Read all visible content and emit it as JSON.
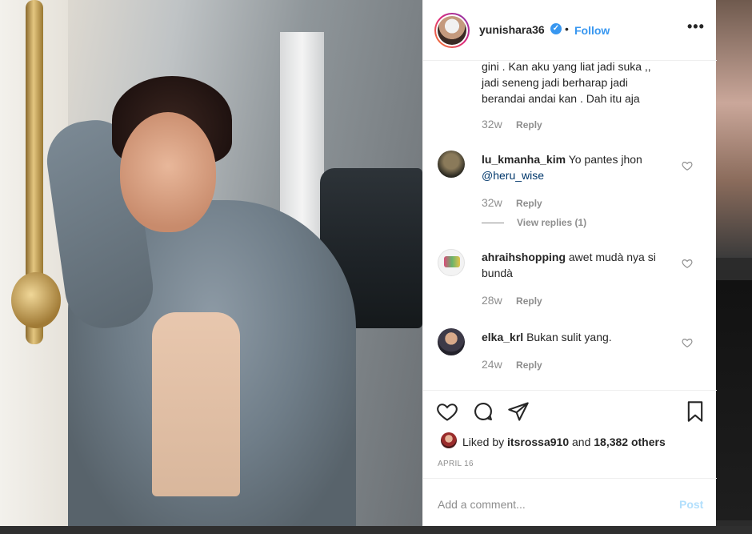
{
  "post": {
    "username": "yunishara36",
    "follow_label": "Follow",
    "separator": "•",
    "more_label": "•••"
  },
  "comments": [
    {
      "id": "c0",
      "text_lines": [
        "gini . Kan aku yang liat jadi suka ,,",
        "jadi seneng jadi berharap jadi",
        "berandai andai kan . Dah itu aja"
      ],
      "age": "32w",
      "reply_label": "Reply"
    },
    {
      "id": "c1",
      "username": "lu_kmanha_kim",
      "text": "Yo pantes jhon",
      "mention": "@heru_wise",
      "age": "32w",
      "reply_label": "Reply",
      "view_replies": "View replies (1)"
    },
    {
      "id": "c2",
      "username": "ahraihshopping",
      "text": "awet mudà nya si",
      "text2": "bundà",
      "age": "28w",
      "reply_label": "Reply"
    },
    {
      "id": "c3",
      "username": "elka_krl",
      "text": "Bukan sulit yang.",
      "age": "24w",
      "reply_label": "Reply"
    }
  ],
  "likes": {
    "prefix": "Liked by",
    "user": "itsrossa910",
    "and": "and",
    "count": "18,382 others"
  },
  "date": "APRIL 16",
  "add_comment": {
    "placeholder": "Add a comment...",
    "post_label": "Post"
  },
  "colors": {
    "link": "#3897f0",
    "muted": "#8e8e8e",
    "post_disabled": "#b2dffc"
  }
}
